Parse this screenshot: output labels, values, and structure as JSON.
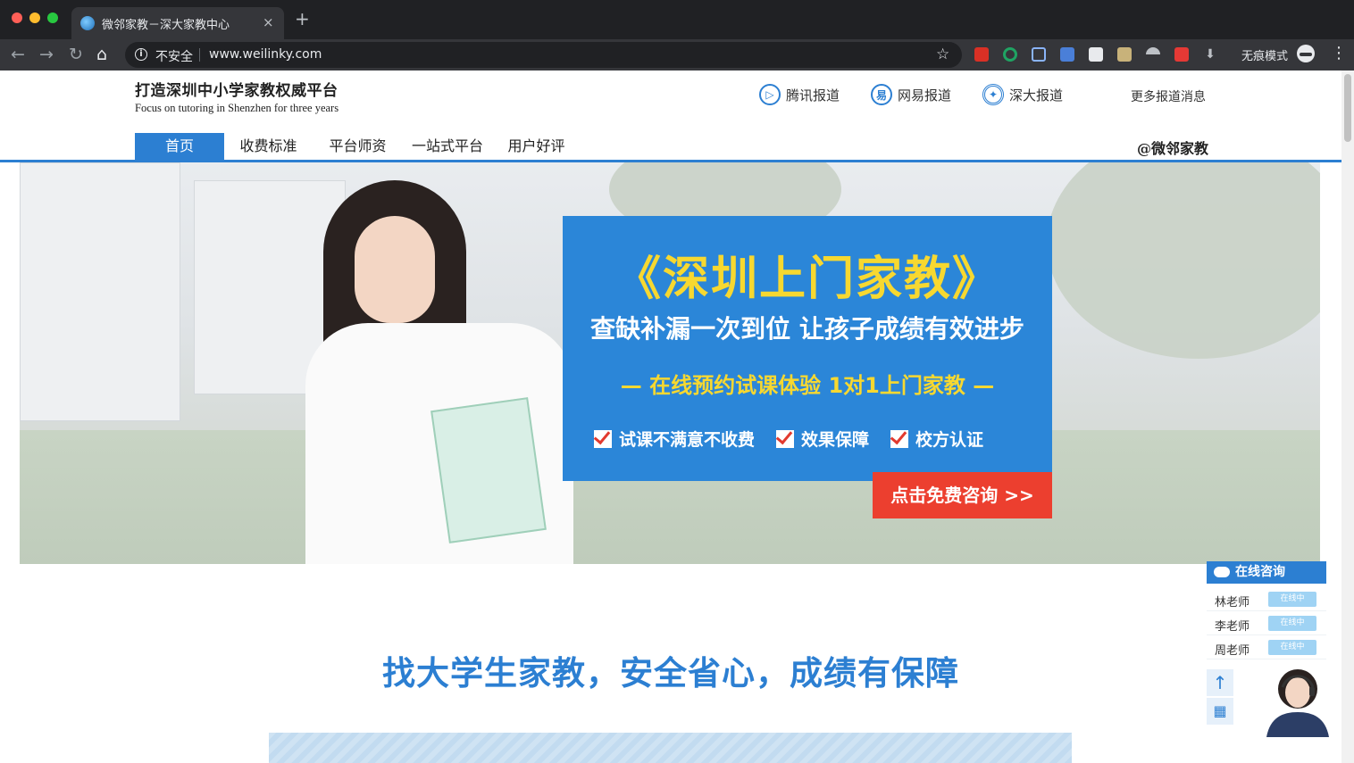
{
  "browser": {
    "tab_title": "微邻家教－深大家教中心",
    "tab_close": "×",
    "new_tab": "+",
    "security_label": "不安全",
    "url": "www.weilinky.com",
    "incognito_label": "无痕模式",
    "nav_icons": [
      "back-arrow-icon",
      "forward-arrow-icon",
      "reload-icon",
      "home-icon"
    ],
    "extension_icons": [
      "adblock-icon",
      "grammarly-icon",
      "screenshot-icon",
      "qr-code-icon",
      "s-extension-icon",
      "image-extension-icon",
      "umbrella-icon",
      "video-extension-icon",
      "download-icon"
    ]
  },
  "header": {
    "slogan_cn": "打造深圳中小学家教权威平台",
    "slogan_en": "Focus on tutoring in Shenzhen for three years",
    "reports": [
      {
        "label": "腾讯报道",
        "icon": "tencent-video-icon"
      },
      {
        "label": "网易报道",
        "icon": "netease-icon"
      },
      {
        "label": "深大报道",
        "icon": "szu-emblem-icon"
      }
    ],
    "more_reports": "更多报道消息"
  },
  "nav": {
    "items": [
      "首页",
      "收费标准",
      "平台师资",
      "一站式平台",
      "用户好评"
    ],
    "active_index": 0,
    "handle": "@微邻家教"
  },
  "banner": {
    "title": "《深圳上门家教》",
    "subtitle": "查缺补漏一次到位 让孩子成绩有效进步",
    "tagline": "— 在线预约试课体验 1对1上门家教 —",
    "checks": [
      "试课不满意不收费",
      "效果保障",
      "校方认证"
    ],
    "cta": "点击免费咨询 >>"
  },
  "main": {
    "headline": "找大学生家教，安全省心，成绩有保障"
  },
  "consult": {
    "title": "在线咨询",
    "teachers": [
      {
        "name": "林老师",
        "status": "在线中"
      },
      {
        "name": "李老师",
        "status": "在线中"
      },
      {
        "name": "周老师",
        "status": "在线中"
      }
    ],
    "top_icon": "back-to-top-icon",
    "qr_icon": "qr-code-icon"
  },
  "colors": {
    "brand_blue": "#2c7fd2",
    "promo_yellow": "#f7d830",
    "cta_red": "#ec3f2f"
  }
}
